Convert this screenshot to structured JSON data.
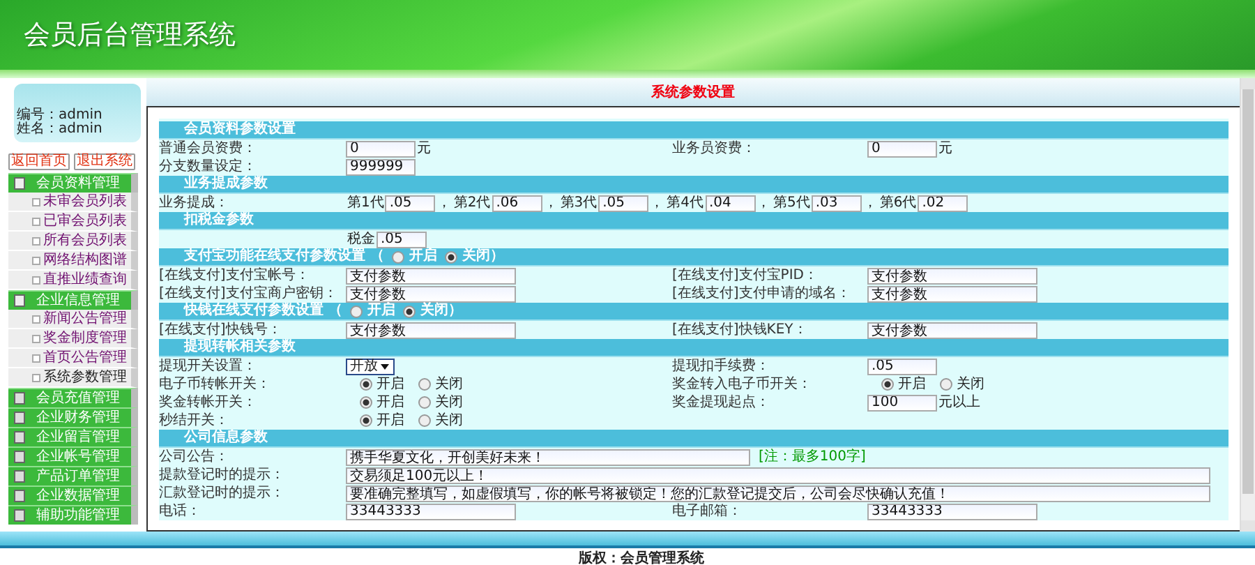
{
  "header": {
    "title": "会员后台管理系统"
  },
  "user_info": [
    {
      "label": "编号：",
      "value": "admin"
    },
    {
      "label": "姓名：",
      "value": "admin"
    }
  ],
  "sidebar_buttons": [
    "返回首页",
    "退出系统"
  ],
  "menu": [
    {
      "label": "会员资料管理",
      "expanded": true,
      "children": [
        {
          "label": "未审会员列表",
          "selected": false
        },
        {
          "label": "已审会员列表",
          "selected": false
        },
        {
          "label": "所有会员列表",
          "selected": false
        },
        {
          "label": "网络结构图谱",
          "selected": false
        },
        {
          "label": "直推业绩查询",
          "selected": false
        }
      ]
    },
    {
      "label": "企业信息管理",
      "expanded": true,
      "children": [
        {
          "label": "新闻公告管理",
          "selected": false
        },
        {
          "label": "奖金制度管理",
          "selected": false
        },
        {
          "label": "首页公告管理",
          "selected": false
        },
        {
          "label": "系统参数管理",
          "selected": true
        }
      ]
    },
    {
      "label": "会员充值管理",
      "expanded": false
    },
    {
      "label": "企业财务管理",
      "expanded": false
    },
    {
      "label": "企业留言管理",
      "expanded": false
    },
    {
      "label": "企业帐号管理",
      "expanded": false
    },
    {
      "label": "产品订单管理",
      "expanded": false
    },
    {
      "label": "企业数据管理",
      "expanded": false
    },
    {
      "label": "辅助功能管理",
      "expanded": false
    }
  ],
  "page_title": "系统参数设置",
  "sections": [
    {
      "title": "会员资料参数设置",
      "rows": [
        {
          "fields": [
            {
              "label": "普通会员资费：",
              "controls": [
                {
                  "kind": "shortinput",
                  "value": "0"
                },
                {
                  "kind": "text",
                  "text": "元"
                }
              ]
            },
            {
              "label": "业务员资费：",
              "controls": [
                {
                  "kind": "shortinput",
                  "value": "0"
                },
                {
                  "kind": "text",
                  "text": "元"
                }
              ]
            }
          ]
        },
        {
          "fields": [
            {
              "label": "分支数量设定：",
              "controls": [
                {
                  "kind": "shortinput",
                  "value": "999999"
                }
              ]
            }
          ]
        }
      ]
    },
    {
      "title": "业务提成参数",
      "rows": [
        {
          "fields": [
            {
              "label": "业务提成：",
              "controls": [
                {
                  "kind": "text",
                  "text": "第1代"
                },
                {
                  "kind": "tinyinput",
                  "value": ".05"
                },
                {
                  "kind": "text",
                  "text": "，"
                },
                {
                  "kind": "text",
                  "text": "第2代"
                },
                {
                  "kind": "tinyinput",
                  "value": ".06"
                },
                {
                  "kind": "text",
                  "text": "，"
                },
                {
                  "kind": "text",
                  "text": "第3代"
                },
                {
                  "kind": "tinyinput",
                  "value": ".05"
                },
                {
                  "kind": "text",
                  "text": "，"
                },
                {
                  "kind": "text",
                  "text": "第4代"
                },
                {
                  "kind": "tinyinput",
                  "value": ".04"
                },
                {
                  "kind": "text",
                  "text": "，"
                },
                {
                  "kind": "text",
                  "text": "第5代"
                },
                {
                  "kind": "tinyinput",
                  "value": ".03"
                },
                {
                  "kind": "text",
                  "text": "，"
                },
                {
                  "kind": "text",
                  "text": "第6代"
                },
                {
                  "kind": "tinyinput",
                  "value": ".02"
                }
              ]
            }
          ]
        }
      ]
    },
    {
      "title": "扣税金参数",
      "rows": [
        {
          "fields": [
            {
              "controls": [
                {
                  "kind": "text",
                  "text": "税金"
                },
                {
                  "kind": "tinyinput",
                  "value": ".05"
                }
              ]
            }
          ]
        }
      ]
    },
    {
      "title": "支付宝功能在线支付参数设置 （",
      "toggle": [
        {
          "label": "开启",
          "selected": false
        },
        {
          "label": "关闭",
          "selected": true
        }
      ],
      "title_end": "）",
      "rows": [
        {
          "fields": [
            {
              "label": "[在线支付]支付宝帐号：",
              "controls": [
                {
                  "kind": "input",
                  "value": "支付参数"
                }
              ]
            },
            {
              "label": "[在线支付]支付宝PID：",
              "controls": [
                {
                  "kind": "input",
                  "value": "支付参数"
                }
              ]
            }
          ]
        },
        {
          "fields": [
            {
              "label": "[在线支付]支付宝商户密钥：",
              "controls": [
                {
                  "kind": "input",
                  "value": "支付参数"
                }
              ]
            },
            {
              "label": "[在线支付]支付申请的域名：",
              "controls": [
                {
                  "kind": "input",
                  "value": "支付参数"
                }
              ]
            }
          ]
        }
      ]
    },
    {
      "title": "快钱在线支付参数设置 （",
      "toggle": [
        {
          "label": "开启",
          "selected": false
        },
        {
          "label": "关闭",
          "selected": true
        }
      ],
      "title_end": "）",
      "rows": [
        {
          "fields": [
            {
              "label": "[在线支付]快钱号：",
              "controls": [
                {
                  "kind": "input",
                  "value": "支付参数"
                }
              ]
            },
            {
              "label": "[在线支付]快钱KEY：",
              "controls": [
                {
                  "kind": "input",
                  "value": "支付参数"
                }
              ]
            }
          ]
        }
      ]
    },
    {
      "title": "提现转帐相关参数",
      "rows": [
        {
          "fields": [
            {
              "label": "提现开关设置：",
              "controls": [
                {
                  "kind": "select",
                  "value": "开放"
                }
              ]
            },
            {
              "label": "提现扣手续费：",
              "controls": [
                {
                  "kind": "shortinput",
                  "value": ".05"
                }
              ]
            }
          ]
        },
        {
          "fields": [
            {
              "label": "电子币转帐开关：",
              "controls": [
                {
                  "kind": "radio",
                  "options": [
                    {
                      "label": "开启",
                      "selected": true
                    },
                    {
                      "label": "关闭",
                      "selected": false
                    }
                  ]
                }
              ]
            },
            {
              "label": "奖金转入电子币开关：",
              "controls": [
                {
                  "kind": "radio",
                  "options": [
                    {
                      "label": "开启",
                      "selected": true
                    },
                    {
                      "label": "关闭",
                      "selected": false
                    }
                  ]
                }
              ]
            }
          ]
        },
        {
          "fields": [
            {
              "label": "奖金转帐开关：",
              "controls": [
                {
                  "kind": "radio",
                  "options": [
                    {
                      "label": "开启",
                      "selected": true
                    },
                    {
                      "label": "关闭",
                      "selected": false
                    }
                  ]
                }
              ]
            },
            {
              "label": "奖金提现起点：",
              "controls": [
                {
                  "kind": "shortinput",
                  "value": "100"
                },
                {
                  "kind": "text",
                  "text": "元以上"
                }
              ]
            }
          ]
        },
        {
          "fields": [
            {
              "label": "秒结开关：",
              "controls": [
                {
                  "kind": "radio",
                  "options": [
                    {
                      "label": "开启",
                      "selected": true
                    },
                    {
                      "label": "关闭",
                      "selected": false
                    }
                  ]
                }
              ]
            }
          ]
        }
      ]
    },
    {
      "title": "公司信息参数",
      "rows": [
        {
          "fields": [
            {
              "label": "公司公告：",
              "controls": [
                {
                  "kind": "longinput",
                  "value": "携手华夏文化，开创美好未来！"
                },
                {
                  "kind": "note",
                  "text": "[注：最多100字]"
                }
              ]
            }
          ]
        },
        {
          "fields": [
            {
              "label": "提款登记时的提示：",
              "controls": [
                {
                  "kind": "fullinput",
                  "value": "交易须足100元以上！"
                }
              ]
            }
          ]
        },
        {
          "fields": [
            {
              "label": "汇款登记时的提示：",
              "controls": [
                {
                  "kind": "fullinput",
                  "value": "要准确完整填写，如虚假填写，你的帐号将被锁定！您的汇款登记提交后，公司会尽快确认充值！"
                }
              ]
            }
          ]
        },
        {
          "fields": [
            {
              "label": "电话：",
              "controls": [
                {
                  "kind": "input",
                  "value": "33443333"
                }
              ]
            },
            {
              "label": "电子邮箱：",
              "controls": [
                {
                  "kind": "input",
                  "value": "33443333"
                }
              ]
            }
          ]
        }
      ]
    }
  ],
  "footer": {
    "text": "版权：会员管理系统"
  }
}
